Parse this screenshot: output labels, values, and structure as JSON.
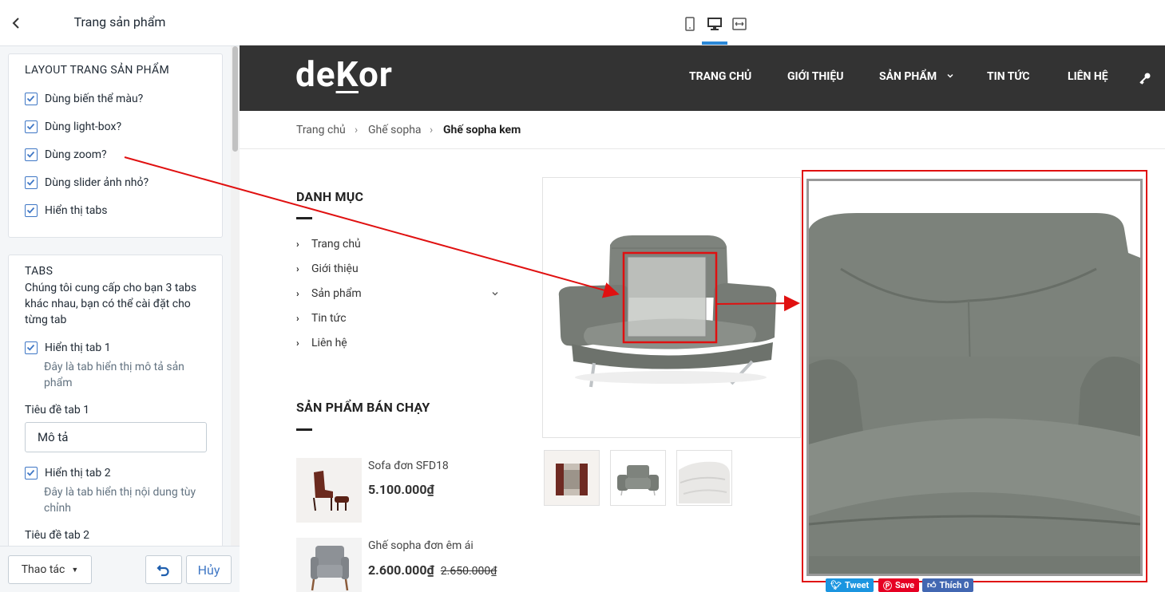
{
  "panel": {
    "title": "Trang sản phẩm",
    "layout_card": {
      "title": "LAYOUT TRANG SẢN PHẨM",
      "options": [
        {
          "label": "Dùng biến thể màu?",
          "checked": true
        },
        {
          "label": "Dùng light-box?",
          "checked": true
        },
        {
          "label": "Dùng zoom?",
          "checked": true
        },
        {
          "label": "Dùng slider ảnh nhỏ?",
          "checked": true
        },
        {
          "label": "Hiển thị tabs",
          "checked": true
        }
      ]
    },
    "tabs_card": {
      "title": "TABS",
      "description": "Chúng tôi cung cấp cho bạn 3 tabs khác nhau, bạn có thể cài đặt cho từng tab",
      "tab1_checkbox": "Hiển thị tab 1",
      "tab1_help": "Đây là tab hiển thị mô tả sản phẩm",
      "tab1_title_label": "Tiêu đề tab 1",
      "tab1_title_value": "Mô tả",
      "tab2_checkbox": "Hiển thị tab 2",
      "tab2_help": "Đây là tab hiển thị nội dung tùy chỉnh",
      "tab2_title_label": "Tiêu đề tab 2"
    },
    "footer": {
      "actions_label": "Thao tác",
      "cancel_label": "Hủy"
    }
  },
  "preview": {
    "logo": "deKor",
    "nav": [
      "TRANG CHỦ",
      "GIỚI THIỆU",
      "SẢN PHẨM",
      "TIN TỨC",
      "LIÊN HỆ"
    ],
    "breadcrumb": [
      "Trang chủ",
      "Ghế sopha",
      "Ghế sopha kem"
    ],
    "category_heading": "DANH MỤC",
    "categories": [
      "Trang chủ",
      "Giới thiệu",
      "Sản phẩm",
      "Tin tức",
      "Liên hệ"
    ],
    "bestseller_heading": "SẢN PHẨM BÁN CHẠY",
    "products": [
      {
        "name": "Sofa đơn SFD18",
        "price": "5.100.000₫",
        "old_price": ""
      },
      {
        "name": "Ghế sopha đơn êm ái",
        "price": "2.600.000₫",
        "old_price": "2.650.000₫"
      }
    ],
    "social": {
      "tweet": "Tweet",
      "save": "Save",
      "like": "Thích 0"
    }
  },
  "colors": {
    "header_bg": "#333333",
    "annotation_red": "#e01010",
    "checkbox_blue": "#3f77c5",
    "device_active": "#2a88d8"
  }
}
